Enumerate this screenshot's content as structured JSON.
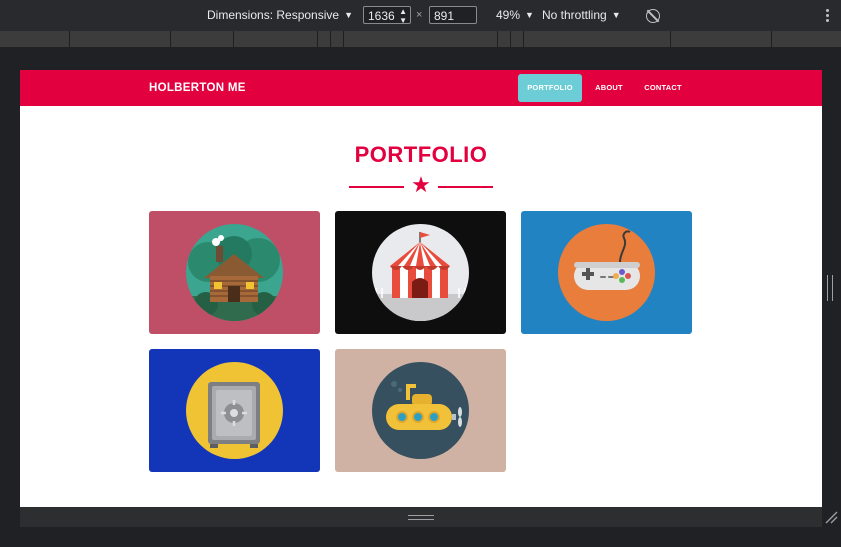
{
  "devtools": {
    "dimensions_label": "Dimensions: Responsive",
    "width_value": "1636",
    "height_value": "891",
    "separator": "×",
    "zoom": "49%",
    "throttling": "No throttling"
  },
  "site": {
    "brand": "HOLBERTON ME",
    "nav": [
      {
        "label": "PORTFOLIO",
        "active": true
      },
      {
        "label": "ABOUT",
        "active": false
      },
      {
        "label": "CONTACT",
        "active": false
      }
    ],
    "section_title": "PORTFOLIO",
    "divider_icon": "star-icon",
    "portfolio_items": [
      {
        "icon": "log-cabin-icon",
        "background": "#be4f67"
      },
      {
        "icon": "circus-tent-icon",
        "background": "#0f0e0e"
      },
      {
        "icon": "gamepad-icon",
        "background": "#2283c2"
      },
      {
        "icon": "safe-icon",
        "background": "#1336b9"
      },
      {
        "icon": "submarine-icon",
        "background": "#d0b2a4"
      }
    ]
  },
  "colors": {
    "brand_red": "#e2003e",
    "nav_active": "#6ccdd6"
  }
}
